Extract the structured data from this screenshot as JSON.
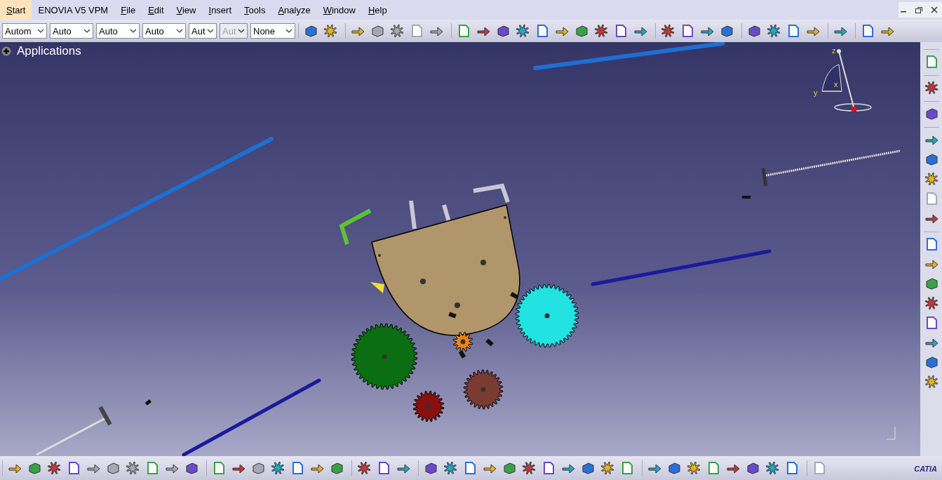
{
  "menu_bar": {
    "items": [
      {
        "label": "Start",
        "selected": true,
        "underlined": true
      },
      {
        "label": "ENOVIA V5 VPM",
        "selected": false,
        "underlined": false
      },
      {
        "label": "File",
        "selected": false,
        "underlined": true
      },
      {
        "label": "Edit",
        "selected": false,
        "underlined": true
      },
      {
        "label": "View",
        "selected": false,
        "underlined": true
      },
      {
        "label": "Insert",
        "selected": false,
        "underlined": true
      },
      {
        "label": "Tools",
        "selected": false,
        "underlined": true
      },
      {
        "label": "Analyze",
        "selected": false,
        "underlined": true
      },
      {
        "label": "Window",
        "selected": false,
        "underlined": true
      },
      {
        "label": "Help",
        "selected": false,
        "underlined": true
      }
    ]
  },
  "graphic_properties": {
    "dropdowns": [
      {
        "value": "Autom",
        "disabled": false
      },
      {
        "value": "Auto",
        "disabled": false
      },
      {
        "value": "Auto",
        "disabled": false
      },
      {
        "value": "Auto",
        "disabled": false
      },
      {
        "value": "Aut",
        "disabled": false
      },
      {
        "value": "Aut",
        "disabled": true
      },
      {
        "value": "None",
        "disabled": false
      }
    ]
  },
  "top_toolbar": {
    "groups": [
      [
        {
          "disabled": false
        },
        {
          "disabled": false
        }
      ],
      [
        {
          "disabled": false
        },
        {
          "disabled": true
        },
        {
          "disabled": true
        },
        {
          "disabled": true
        },
        {
          "disabled": true
        }
      ],
      [
        {
          "disabled": false
        },
        {
          "disabled": false
        },
        {
          "disabled": false
        },
        {
          "disabled": false
        },
        {
          "disabled": false
        },
        {
          "disabled": false
        },
        {
          "disabled": false
        },
        {
          "disabled": false
        },
        {
          "disabled": false
        },
        {
          "disabled": false
        }
      ],
      [
        {
          "disabled": false
        },
        {
          "disabled": false
        },
        {
          "disabled": false
        },
        {
          "disabled": false
        }
      ],
      [
        {
          "disabled": false
        },
        {
          "disabled": false
        },
        {
          "disabled": false
        },
        {
          "disabled": false
        }
      ],
      [
        {
          "disabled": false
        }
      ],
      [
        {
          "disabled": false
        },
        {
          "disabled": false
        }
      ]
    ]
  },
  "tree": {
    "root": "Applications"
  },
  "compass": {
    "labels": [
      "z",
      "x",
      "y"
    ]
  },
  "right_toolbar": {
    "groups": [
      [
        {
          "disabled": false
        }
      ],
      [
        {
          "disabled": false
        }
      ],
      [
        {
          "disabled": false
        }
      ],
      [
        {
          "disabled": false
        },
        {
          "disabled": false
        },
        {
          "disabled": false
        },
        {
          "disabled": true
        },
        {
          "disabled": false
        }
      ],
      [
        {
          "disabled": false
        },
        {
          "disabled": false
        },
        {
          "disabled": false
        },
        {
          "disabled": false
        },
        {
          "disabled": false
        },
        {
          "disabled": false
        },
        {
          "disabled": false
        },
        {
          "disabled": false
        }
      ]
    ]
  },
  "bottom_toolbar": {
    "groups": [
      [
        {
          "disabled": false
        },
        {
          "disabled": false
        },
        {
          "disabled": false
        },
        {
          "disabled": false
        },
        {
          "disabled": true
        },
        {
          "disabled": true
        },
        {
          "disabled": true
        },
        {
          "disabled": false
        },
        {
          "disabled": true
        },
        {
          "disabled": false
        }
      ],
      [
        {
          "disabled": false
        },
        {
          "disabled": false
        },
        {
          "disabled": true
        },
        {
          "disabled": false
        },
        {
          "disabled": false
        },
        {
          "disabled": false
        },
        {
          "disabled": false
        }
      ],
      [
        {
          "disabled": false
        },
        {
          "disabled": false
        },
        {
          "disabled": false
        }
      ],
      [
        {
          "disabled": false
        },
        {
          "disabled": false
        },
        {
          "disabled": false
        },
        {
          "disabled": false
        },
        {
          "disabled": false
        },
        {
          "disabled": false
        },
        {
          "disabled": false
        },
        {
          "disabled": false
        },
        {
          "disabled": false
        },
        {
          "disabled": false
        },
        {
          "disabled": false
        }
      ],
      [
        {
          "disabled": false
        },
        {
          "disabled": false
        },
        {
          "disabled": false
        },
        {
          "disabled": false
        },
        {
          "disabled": false
        },
        {
          "disabled": false
        },
        {
          "disabled": false
        },
        {
          "disabled": false
        }
      ],
      [
        {
          "disabled": true
        }
      ]
    ]
  },
  "logo": {
    "text": "CATIA"
  }
}
